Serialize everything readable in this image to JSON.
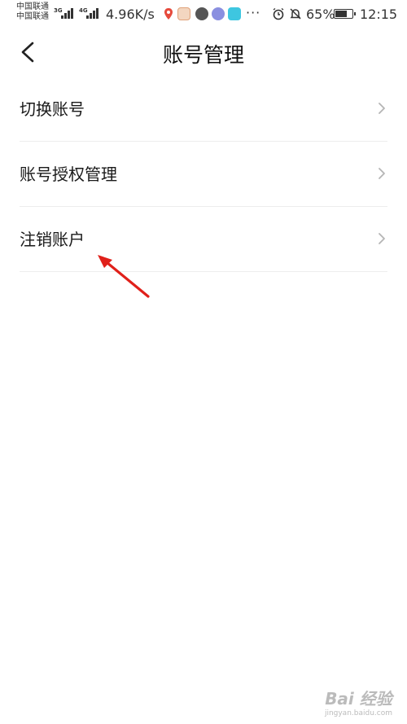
{
  "status_bar": {
    "carrier_1": "中国联通",
    "carrier_2": "中国联通",
    "net_1": "3G",
    "net_2": "4G",
    "speed": "4.96K/s",
    "more": "···",
    "battery_percent": "65%",
    "battery_level": 0.65,
    "time": "12:15"
  },
  "header": {
    "title": "账号管理",
    "back_icon": "chevron-left-icon"
  },
  "menu": {
    "items": [
      {
        "label": "切换账号",
        "icon": "chevron-right-icon"
      },
      {
        "label": "账号授权管理",
        "icon": "chevron-right-icon"
      },
      {
        "label": "注销账户",
        "icon": "chevron-right-icon"
      }
    ]
  },
  "annotation": {
    "color": "#e0201a"
  },
  "watermark": {
    "logo": "Bai 经验",
    "url": "jingyan.baidu.com"
  }
}
